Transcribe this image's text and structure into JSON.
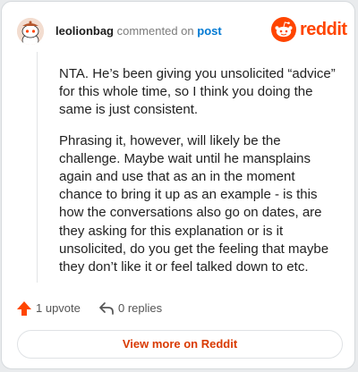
{
  "header": {
    "username": "leolionbag",
    "commented_text": "commented on",
    "post_link": "post",
    "brand_name": "reddit"
  },
  "comment": {
    "paragraphs": [
      "NTA. He’s been giving you unsolicited “advice” for this whole time, so I think you doing the same is just consistent.",
      "Phrasing it, however, will likely be the challenge. Maybe wait until he mansplains again and use that as an in the moment chance to bring it up as an example - is this how the conversations also go on dates, are they asking for this explanation or is it unsolicited, do you get the feeling that maybe they don’t like it or feel talked down to etc."
    ]
  },
  "actions": {
    "upvote_label": "1 upvote",
    "replies_label": "0 replies"
  },
  "footer": {
    "view_more_label": "View more on Reddit"
  },
  "colors": {
    "brand": "#ff4500",
    "link": "#0079d3",
    "view_more_text": "#d93a00"
  },
  "icons": {
    "avatar": "snoo-avatar",
    "brand": "reddit-snoo-logo",
    "upvote": "upvote-arrow-icon",
    "replies": "reply-arrow-icon"
  }
}
